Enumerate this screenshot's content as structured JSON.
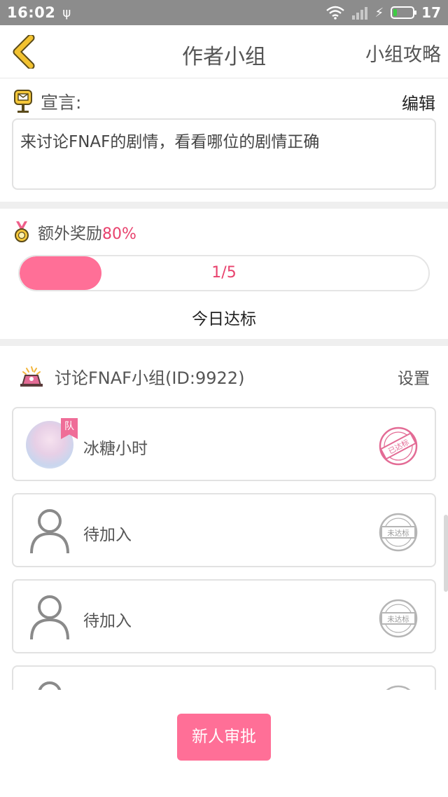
{
  "status_bar": {
    "time": "16:02",
    "battery_level": "17"
  },
  "nav": {
    "title": "作者小组",
    "guide_label": "小组攻略"
  },
  "declaration": {
    "label": "宣言:",
    "edit_label": "编辑",
    "text": "来讨论FNAF的剧情，看看哪位的剧情正确"
  },
  "bonus": {
    "label": "额外奖励",
    "percent": "80%",
    "progress_text": "1/5",
    "progress_fraction": 0.2,
    "today_label": "今日达标"
  },
  "group": {
    "name": "讨论FNAF小组(ID:9922)",
    "settings_label": "设置",
    "members": [
      {
        "name": "冰糖小时",
        "captain_badge": "队",
        "stamp_text": "已达标",
        "stamp_color": "#e36b95"
      },
      {
        "name": "待加入",
        "stamp_text": "未达标",
        "stamp_color": "#b5b5b5"
      },
      {
        "name": "待加入",
        "stamp_text": "未达标",
        "stamp_color": "#b5b5b5"
      },
      {
        "name": "",
        "stamp_text": "",
        "stamp_color": "#b5b5b5"
      }
    ]
  },
  "approve_button": {
    "label": "新人审批"
  },
  "colors": {
    "accent": "#ff6f97",
    "accent_text": "#e8426d",
    "back_arrow": "#f2c230"
  }
}
